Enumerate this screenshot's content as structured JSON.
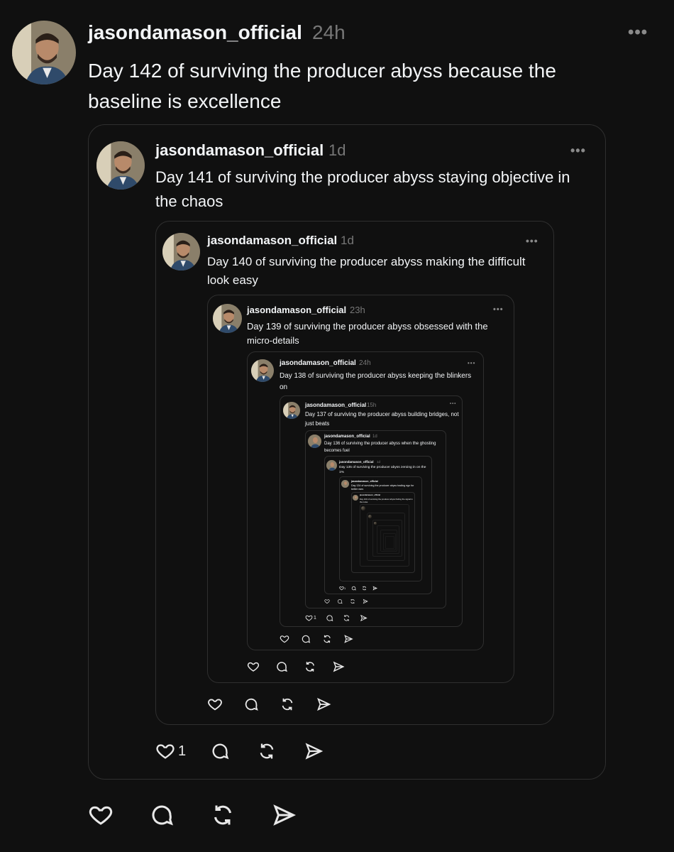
{
  "posts": [
    {
      "username": "jasondamason_official",
      "time": "24h",
      "text": "Day 142 of surviving the producer abyss because the baseline is excellence",
      "likes": ""
    },
    {
      "username": "jasondamason_official",
      "time": "1d",
      "text": "Day 141 of surviving the producer abyss staying objective in the chaos",
      "likes": "1"
    },
    {
      "username": "jasondamason_official",
      "time": "1d",
      "text": "Day 140 of surviving the producer abyss making the difficult look easy",
      "likes": ""
    },
    {
      "username": "jasondamason_official",
      "time": "23h",
      "text": "Day 139 of surviving the producer abyss obsessed with the micro-details",
      "likes": ""
    },
    {
      "username": "jasondamason_official",
      "time": "24h",
      "text": "Day 138 of surviving the producer abyss keeping the blinkers on",
      "likes": ""
    },
    {
      "username": "jasondamason_official",
      "time": "15h",
      "text": "Day 137 of surviving the producer abyss building bridges, not just beats",
      "likes": "1"
    },
    {
      "username": "jasondamason_official",
      "time": "1d",
      "text": "Day 136 of surviving the producer abyss when the ghosting becomes fuel",
      "likes": ""
    },
    {
      "username": "jasondamason_official",
      "time": "1d",
      "text": "Day 135 of surviving the producer abyss zeroing in on the 1%",
      "likes": "1"
    },
    {
      "username": "jasondamason_official",
      "time": "1d",
      "text": "Day 134 of surviving the producer abyss trading ego for better ears",
      "likes": ""
    },
    {
      "username": "jasondamason_official",
      "time": "1d",
      "text": "Day 133 of surviving the producer abyss finding the signal in the noise",
      "likes": ""
    }
  ],
  "icons": [
    "heart-icon",
    "comment-icon",
    "repost-icon",
    "share-icon",
    "more-icon"
  ],
  "colors": {
    "background": "#101010",
    "text": "#f3f5f7",
    "muted": "#777777",
    "border": "#2f2f2f"
  }
}
